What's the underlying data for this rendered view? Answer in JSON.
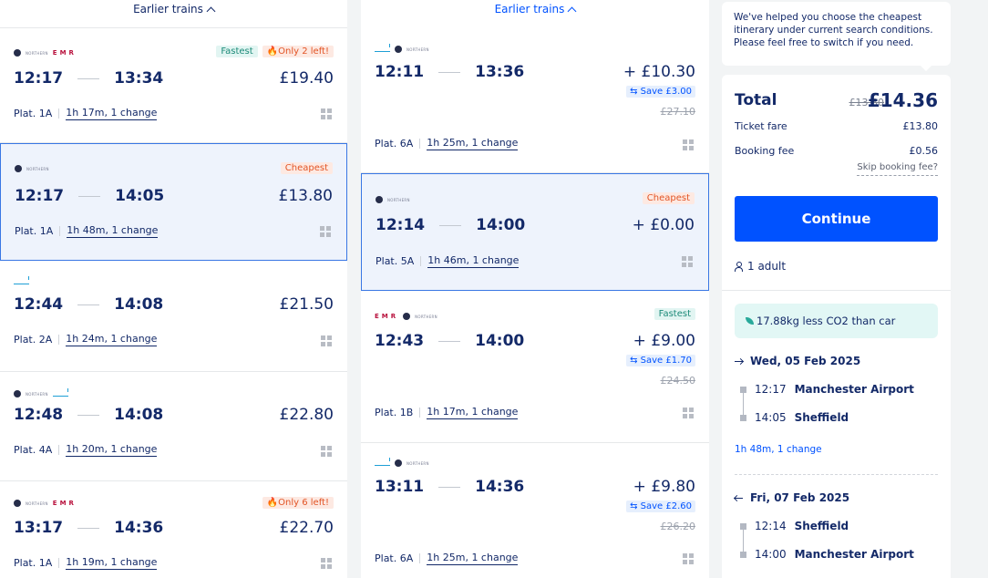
{
  "left_column": {
    "earlier_label": "Earlier trains",
    "cards": [
      {
        "badges": [
          "Fastest",
          "Only 2 left!"
        ],
        "dep": "12:17",
        "arr": "13:34",
        "price": "£19.40",
        "platform": "Plat. 1A",
        "duration": "1h 17m, 1 change"
      },
      {
        "badges": [
          "Cheapest"
        ],
        "dep": "12:17",
        "arr": "14:05",
        "price": "£13.80",
        "platform": "Plat. 1A",
        "duration": "1h 48m, 1 change"
      },
      {
        "badges": [],
        "dep": "12:44",
        "arr": "14:08",
        "price": "£21.50",
        "platform": "Plat. 2A",
        "duration": "1h 24m, 1 change"
      },
      {
        "badges": [],
        "dep": "12:48",
        "arr": "14:08",
        "price": "£22.80",
        "platform": "Plat. 4A",
        "duration": "1h 20m, 1 change"
      },
      {
        "badges": [
          "Only 6 left!"
        ],
        "dep": "13:17",
        "arr": "14:36",
        "price": "£22.70",
        "platform": "Plat. 1A",
        "duration": "1h 19m, 1 change"
      }
    ]
  },
  "right_column": {
    "earlier_label": "Earlier trains",
    "cards": [
      {
        "badges": [],
        "dep": "12:11",
        "arr": "13:36",
        "price": "+ £10.30",
        "save": "Save £3.00",
        "old": "£27.10",
        "platform": "Plat. 6A",
        "duration": "1h 25m, 1 change"
      },
      {
        "badges": [
          "Cheapest"
        ],
        "dep": "12:14",
        "arr": "14:00",
        "price": "+ £0.00",
        "platform": "Plat. 5A",
        "duration": "1h 46m, 1 change"
      },
      {
        "badges": [
          "Fastest"
        ],
        "dep": "12:43",
        "arr": "14:00",
        "price": "+ £9.00",
        "save": "Save £1.70",
        "old": "£24.50",
        "platform": "Plat. 1B",
        "duration": "1h 17m, 1 change"
      },
      {
        "badges": [],
        "dep": "13:11",
        "arr": "14:36",
        "price": "+ £9.80",
        "save": "Save £2.60",
        "old": "£26.20",
        "platform": "Plat. 6A",
        "duration": "1h 25m, 1 change"
      }
    ]
  },
  "operators": {
    "northern": "NORTHERN",
    "emr": "EMR"
  },
  "summary": {
    "tip": "We've helped you choose the cheapest itinerary under current search conditions. Please feel free to switch if you need.",
    "total_label": "Total",
    "old_total": "£13.80",
    "total": "£14.36",
    "ticket_fare_label": "Ticket fare",
    "ticket_fare": "£13.80",
    "booking_fee_label": "Booking fee",
    "booking_fee": "£0.56",
    "skip_fee": "Skip booking fee?",
    "continue": "Continue",
    "passengers": "1 adult",
    "eco": "17.88kg less CO2 than car",
    "outbound": {
      "date": "Wed, 05 Feb 2025",
      "dep_time": "12:17",
      "dep_station": "Manchester Airport",
      "arr_time": "14:05",
      "arr_station": "Sheffield",
      "duration": "1h 48m, 1 change"
    },
    "return": {
      "date": "Fri, 07 Feb 2025",
      "dep_time": "12:14",
      "dep_station": "Sheffield",
      "arr_time": "14:00",
      "arr_station": "Manchester Airport"
    }
  },
  "colors": {
    "accent": "#0052ff",
    "selected_bg": "#eef3fc",
    "badge_cheap": "#e25425",
    "badge_fast": "#1c8a78"
  }
}
